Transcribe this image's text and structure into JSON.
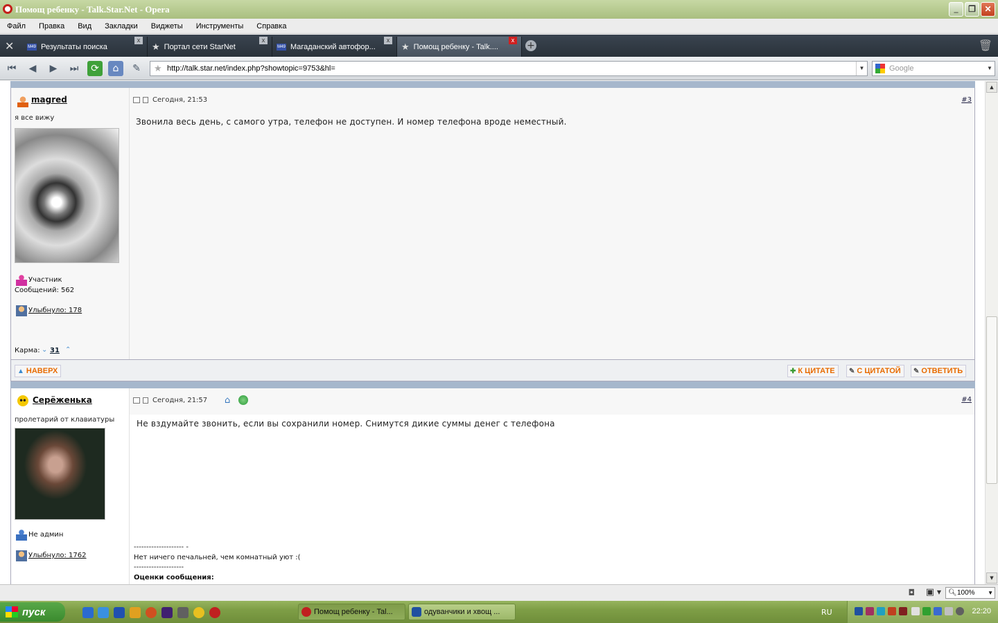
{
  "window": {
    "title": "Помощ ребенку - Talk.Star.Net - Opera"
  },
  "menu": [
    "Файл",
    "Правка",
    "Вид",
    "Закладки",
    "Виджеты",
    "Инструменты",
    "Справка"
  ],
  "tabs": [
    {
      "label": "Результаты поиска"
    },
    {
      "label": "Портал сети StarNet"
    },
    {
      "label": "Магаданский автофор..."
    },
    {
      "label": "Помощ ребенку - Talk...."
    }
  ],
  "tab_favicon_text": "M49",
  "address": {
    "url": "http://talk.star.net/index.php?showtopic=9753&hl=",
    "search_placeholder": "Google"
  },
  "posts": [
    {
      "username": "magred",
      "user_status": "я все вижу",
      "date": "Сегодня, 21:53",
      "number": "#3",
      "message": "Звонила весь день, с самого утра, телефон не доступен. И номер телефона вроде неместный.",
      "group": "Участник",
      "posts_count": "Сообщений: 562",
      "smiled": "Улыбнуло: 178",
      "karma_label": "Карма:",
      "karma_value": "31"
    },
    {
      "username": "Серёженька",
      "user_status": "пролетарий от клавиатуры",
      "date": "Сегодня, 21:57",
      "number": "#4",
      "message": "Не вздумайте звонить, если вы сохранили номер. Снимутся дикие суммы денег с телефона",
      "group": "Не админ",
      "smiled": "Улыбнуло: 1762",
      "signature_line1": "-------------------- -",
      "signature_text": "Нет ничего печальней, чем комнатный уют :(",
      "signature_line2": "--------------------",
      "ratings_label": "Оценки сообщения:"
    }
  ],
  "post_footer": {
    "top": "НАВЕРХ",
    "quote": "К ЦИТАТЕ",
    "with_quote": "С ЦИТАТОЙ",
    "reply": "ОТВЕТИТЬ"
  },
  "statusbar": {
    "zoom": "100%"
  },
  "taskbar": {
    "start": "пуск",
    "buttons": [
      {
        "label": "Помощ ребенку - Tal..."
      },
      {
        "label": "одуванчики и хвощ ..."
      }
    ],
    "lang": "RU",
    "clock": "22:20"
  },
  "colors": {
    "accent": "#e86b00",
    "post_separator": "#a6b7cc",
    "titlebar": "#a9bf80"
  }
}
